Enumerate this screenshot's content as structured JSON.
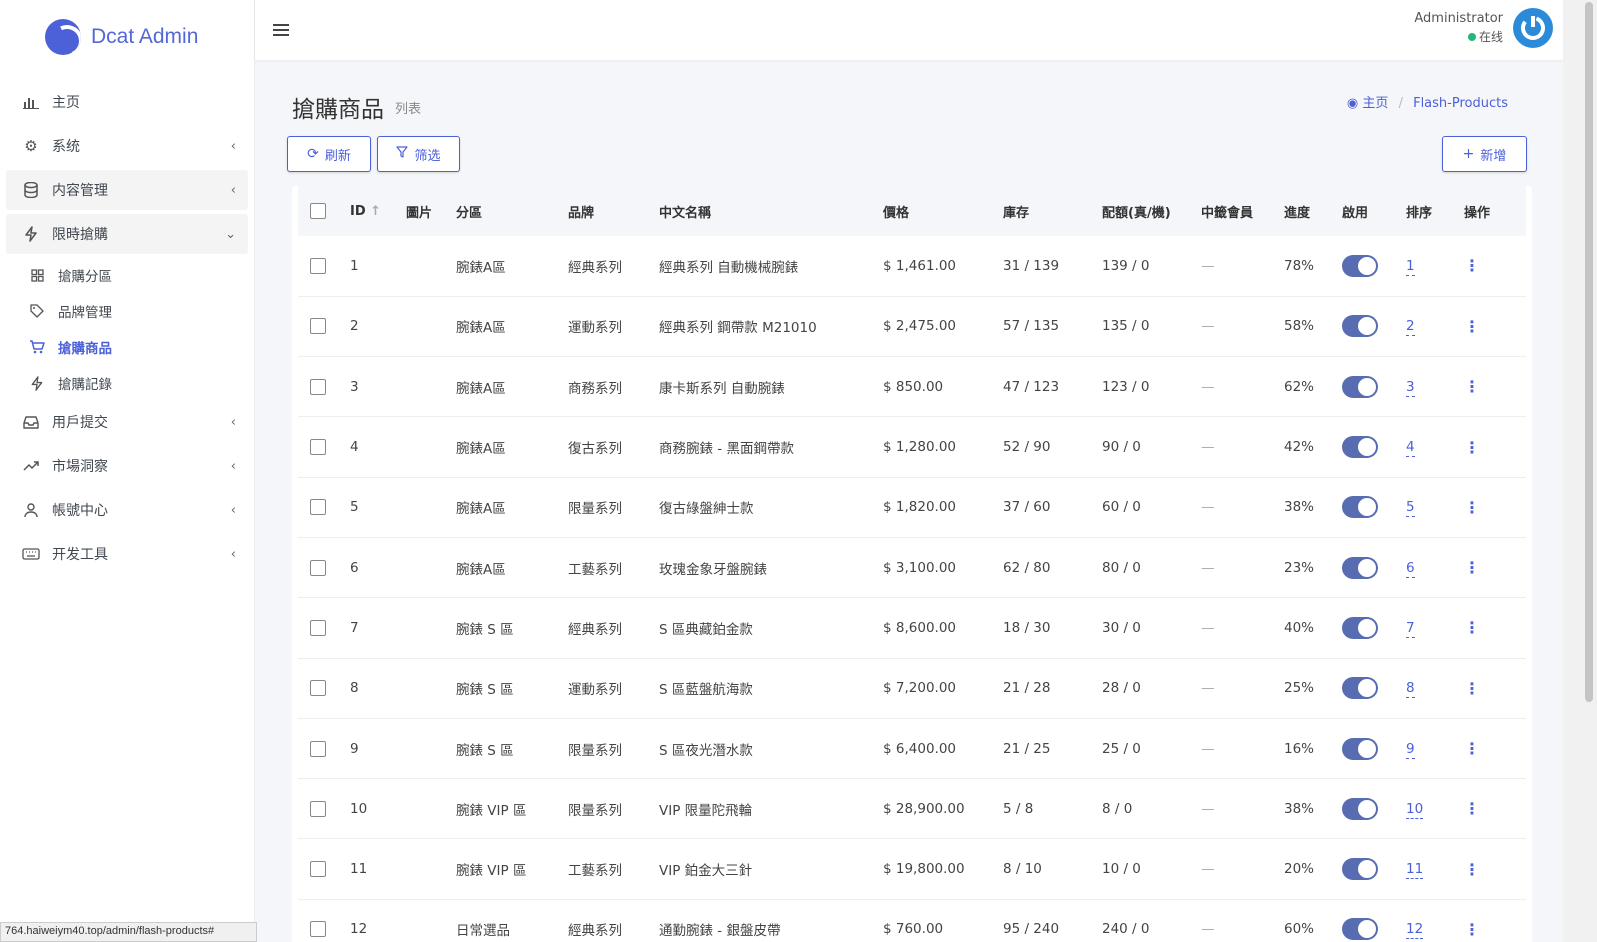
{
  "brand": {
    "name": "Dcat Admin"
  },
  "sidebar": {
    "items": [
      {
        "label": "主页",
        "icon": "bar-chart-icon",
        "arrow": ""
      },
      {
        "label": "系统",
        "icon": "gear-icon",
        "arrow": "‹"
      },
      {
        "label": "内容管理",
        "icon": "database-icon",
        "arrow": "‹"
      },
      {
        "label": "限時搶購",
        "icon": "lightning-icon",
        "arrow": "⌄"
      }
    ],
    "sub_items": [
      {
        "label": "搶購分區",
        "icon": "grid-icon"
      },
      {
        "label": "品牌管理",
        "icon": "tag-icon"
      },
      {
        "label": "搶購商品",
        "icon": "cart-icon"
      },
      {
        "label": "搶購記錄",
        "icon": "lightning-icon"
      }
    ],
    "items_after": [
      {
        "label": "用戶提交",
        "icon": "inbox-icon",
        "arrow": "‹"
      },
      {
        "label": "市場洞察",
        "icon": "trend-icon",
        "arrow": "‹"
      },
      {
        "label": "帳號中心",
        "icon": "user-icon",
        "arrow": "‹"
      },
      {
        "label": "开发工具",
        "icon": "keyboard-icon",
        "arrow": "‹"
      }
    ]
  },
  "header": {
    "user_name": "Administrator",
    "user_status": "在线"
  },
  "page": {
    "title": "搶購商品",
    "subtitle": "列表",
    "breadcrumb_home": "主页",
    "breadcrumb_current": "Flash-Products"
  },
  "toolbar": {
    "refresh_label": "刷新",
    "filter_label": "筛选",
    "add_label": "新增"
  },
  "table": {
    "columns": [
      "ID",
      "圖片",
      "分區",
      "品牌",
      "中文名稱",
      "價格",
      "庫存",
      "配額(真/機)",
      "中籤會員",
      "進度",
      "啟用",
      "排序",
      "操作"
    ],
    "rows": [
      {
        "id": "1",
        "zone": "腕錶A區",
        "brand": "經典系列",
        "name": "經典系列 自動機械腕錶",
        "price": "$ 1,461.00",
        "stock": "31 / 139",
        "quota": "139 / 0",
        "winner": "—",
        "progress": "78%",
        "sort": "1"
      },
      {
        "id": "2",
        "zone": "腕錶A區",
        "brand": "運動系列",
        "name": "經典系列 鋼帶款 M21010",
        "price": "$ 2,475.00",
        "stock": "57 / 135",
        "quota": "135 / 0",
        "winner": "—",
        "progress": "58%",
        "sort": "2"
      },
      {
        "id": "3",
        "zone": "腕錶A區",
        "brand": "商務系列",
        "name": "康卡斯系列 自動腕錶",
        "price": "$ 850.00",
        "stock": "47 / 123",
        "quota": "123 / 0",
        "winner": "—",
        "progress": "62%",
        "sort": "3"
      },
      {
        "id": "4",
        "zone": "腕錶A區",
        "brand": "復古系列",
        "name": "商務腕錶 - 黑面鋼帶款",
        "price": "$ 1,280.00",
        "stock": "52 / 90",
        "quota": "90 / 0",
        "winner": "—",
        "progress": "42%",
        "sort": "4"
      },
      {
        "id": "5",
        "zone": "腕錶A區",
        "brand": "限量系列",
        "name": "復古綠盤紳士款",
        "price": "$ 1,820.00",
        "stock": "37 / 60",
        "quota": "60 / 0",
        "winner": "—",
        "progress": "38%",
        "sort": "5"
      },
      {
        "id": "6",
        "zone": "腕錶A區",
        "brand": "工藝系列",
        "name": "玫瑰金象牙盤腕錶",
        "price": "$ 3,100.00",
        "stock": "62 / 80",
        "quota": "80 / 0",
        "winner": "—",
        "progress": "23%",
        "sort": "6"
      },
      {
        "id": "7",
        "zone": "腕錶 S 區",
        "brand": "經典系列",
        "name": "S 區典藏鉑金款",
        "price": "$ 8,600.00",
        "stock": "18 / 30",
        "quota": "30 / 0",
        "winner": "—",
        "progress": "40%",
        "sort": "7"
      },
      {
        "id": "8",
        "zone": "腕錶 S 區",
        "brand": "運動系列",
        "name": "S 區藍盤航海款",
        "price": "$ 7,200.00",
        "stock": "21 / 28",
        "quota": "28 / 0",
        "winner": "—",
        "progress": "25%",
        "sort": "8"
      },
      {
        "id": "9",
        "zone": "腕錶 S 區",
        "brand": "限量系列",
        "name": "S 區夜光潛水款",
        "price": "$ 6,400.00",
        "stock": "21 / 25",
        "quota": "25 / 0",
        "winner": "—",
        "progress": "16%",
        "sort": "9"
      },
      {
        "id": "10",
        "zone": "腕錶 VIP 區",
        "brand": "限量系列",
        "name": "VIP 限量陀飛輪",
        "price": "$ 28,900.00",
        "stock": "5 / 8",
        "quota": "8 / 0",
        "winner": "—",
        "progress": "38%",
        "sort": "10"
      },
      {
        "id": "11",
        "zone": "腕錶 VIP 區",
        "brand": "工藝系列",
        "name": "VIP 鉑金大三針",
        "price": "$ 19,800.00",
        "stock": "8 / 10",
        "quota": "10 / 0",
        "winner": "—",
        "progress": "20%",
        "sort": "11"
      },
      {
        "id": "12",
        "zone": "日常選品",
        "brand": "經典系列",
        "name": "通勤腕錶 - 銀盤皮帶",
        "price": "$ 760.00",
        "stock": "95 / 240",
        "quota": "240 / 0",
        "winner": "—",
        "progress": "60%",
        "sort": "12"
      }
    ]
  },
  "statusbar": {
    "url": "764.haiweiym40.top/admin/flash-products#"
  },
  "colors": {
    "accent": "#4c60d8",
    "toggle": "#586cb1",
    "online": "#21b978"
  }
}
